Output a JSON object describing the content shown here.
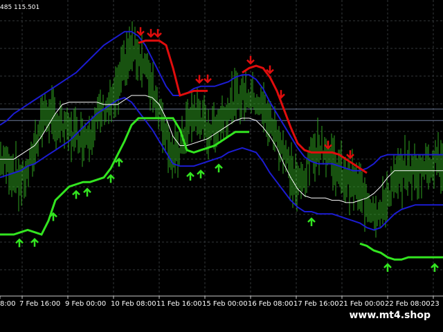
{
  "header": {
    "price_readout": "485 115.501"
  },
  "watermark": "www.mt4.shop",
  "colors": {
    "background": "#000000",
    "grid": "#33373a",
    "price": "#2fa51f",
    "upper_band": "#1c1cd2",
    "lower_band": "#1c1cd2",
    "middle_line": "#ffffff",
    "resistance": "#e00d0d",
    "support": "#33e520",
    "buy_arrow": "#33e520",
    "sell_arrow": "#e00d0d",
    "level_line": "#6e7c9a"
  },
  "chart_data": {
    "type": "line",
    "x_tick_labels": [
      "8:00",
      "7 Feb 16:00",
      "9 Feb 00:00",
      "10 Feb 08:00",
      "11 Feb 16:00",
      "15 Feb 00:00",
      "16 Feb 08:00",
      "17 Feb 16:00",
      "21 Feb 00:00",
      "22 Feb 08:00",
      "23"
    ],
    "x": [
      0,
      10,
      20,
      30,
      40,
      50,
      60,
      70,
      80,
      90,
      100,
      110,
      120,
      130,
      140,
      150,
      160,
      170,
      180,
      190,
      200,
      210,
      220,
      230,
      240,
      250,
      260,
      270,
      280,
      290,
      300,
      310,
      320,
      330,
      340,
      350,
      360,
      370,
      380,
      390,
      400,
      410,
      420,
      430,
      440,
      450,
      460,
      470,
      480,
      490,
      500,
      510,
      520,
      530,
      540,
      550,
      560,
      570,
      580,
      590,
      600,
      610,
      620,
      630,
      640
    ],
    "y_readout": 115.501,
    "series": [
      {
        "role": "price",
        "values": [
          0.4,
          0.38,
          0.34,
          0.3,
          0.34,
          0.45,
          0.58,
          0.6,
          0.56,
          0.54,
          0.52,
          0.51,
          0.5,
          0.52,
          0.58,
          0.62,
          0.64,
          0.7,
          0.82,
          0.88,
          0.86,
          0.8,
          0.72,
          0.62,
          0.52,
          0.4,
          0.44,
          0.54,
          0.6,
          0.58,
          0.52,
          0.54,
          0.58,
          0.62,
          0.66,
          0.68,
          0.68,
          0.66,
          0.62,
          0.56,
          0.5,
          0.44,
          0.34,
          0.28,
          0.32,
          0.42,
          0.46,
          0.44,
          0.4,
          0.34,
          0.32,
          0.3,
          0.26,
          0.22,
          0.18,
          0.16,
          0.24,
          0.3,
          0.34,
          0.36,
          0.34,
          0.36,
          0.38,
          0.4,
          0.4
        ]
      },
      {
        "role": "upper_band",
        "values": [
          0.55,
          0.57,
          0.6,
          0.62,
          0.64,
          0.66,
          0.68,
          0.7,
          0.72,
          0.74,
          0.76,
          0.78,
          0.81,
          0.84,
          0.87,
          0.9,
          0.92,
          0.94,
          0.96,
          0.96,
          0.94,
          0.9,
          0.84,
          0.78,
          0.72,
          0.68,
          0.68,
          0.69,
          0.71,
          0.72,
          0.72,
          0.72,
          0.73,
          0.74,
          0.76,
          0.77,
          0.77,
          0.75,
          0.71,
          0.65,
          0.6,
          0.55,
          0.5,
          0.45,
          0.41,
          0.39,
          0.38,
          0.38,
          0.38,
          0.37,
          0.36,
          0.35,
          0.35,
          0.36,
          0.38,
          0.41,
          0.42,
          0.42,
          0.42,
          0.42,
          0.42,
          0.42,
          0.42,
          0.42,
          0.42
        ]
      },
      {
        "role": "middle_line",
        "values": [
          0.4,
          0.4,
          0.4,
          0.42,
          0.44,
          0.46,
          0.5,
          0.55,
          0.6,
          0.64,
          0.65,
          0.65,
          0.65,
          0.65,
          0.65,
          0.64,
          0.64,
          0.64,
          0.66,
          0.68,
          0.68,
          0.68,
          0.67,
          0.64,
          0.58,
          0.5,
          0.46,
          0.46,
          0.47,
          0.48,
          0.49,
          0.51,
          0.53,
          0.55,
          0.57,
          0.58,
          0.58,
          0.57,
          0.54,
          0.5,
          0.45,
          0.38,
          0.32,
          0.27,
          0.24,
          0.23,
          0.23,
          0.23,
          0.22,
          0.22,
          0.21,
          0.21,
          0.22,
          0.23,
          0.25,
          0.28,
          0.32,
          0.35,
          0.35,
          0.35,
          0.35,
          0.35,
          0.35,
          0.35,
          0.35
        ]
      },
      {
        "role": "lower_band",
        "values": [
          0.32,
          0.33,
          0.34,
          0.35,
          0.37,
          0.38,
          0.4,
          0.42,
          0.44,
          0.46,
          0.48,
          0.51,
          0.54,
          0.57,
          0.6,
          0.62,
          0.64,
          0.66,
          0.67,
          0.65,
          0.61,
          0.57,
          0.53,
          0.48,
          0.43,
          0.38,
          0.37,
          0.37,
          0.37,
          0.38,
          0.39,
          0.4,
          0.41,
          0.43,
          0.44,
          0.45,
          0.44,
          0.43,
          0.39,
          0.34,
          0.3,
          0.26,
          0.22,
          0.19,
          0.17,
          0.17,
          0.16,
          0.16,
          0.16,
          0.15,
          0.14,
          0.13,
          0.12,
          0.1,
          0.09,
          0.1,
          0.13,
          0.16,
          0.18,
          0.19,
          0.2,
          0.2,
          0.2,
          0.2,
          0.2
        ]
      },
      {
        "role": "resistance",
        "values": [
          null,
          null,
          null,
          null,
          null,
          null,
          null,
          null,
          null,
          null,
          null,
          null,
          null,
          null,
          null,
          null,
          null,
          null,
          null,
          null,
          0.91,
          0.92,
          0.92,
          0.92,
          0.9,
          0.8,
          0.68,
          0.69,
          0.7,
          0.7,
          0.7,
          null,
          null,
          null,
          null,
          0.78,
          0.8,
          0.81,
          0.8,
          0.76,
          0.7,
          0.62,
          0.54,
          0.47,
          0.44,
          0.43,
          0.43,
          0.43,
          0.43,
          0.42,
          0.4,
          0.38,
          0.36,
          0.34,
          null,
          null,
          null,
          null,
          null,
          null,
          null,
          null,
          null,
          null,
          null
        ]
      },
      {
        "role": "support",
        "values": [
          0.07,
          0.07,
          0.07,
          0.08,
          0.09,
          0.08,
          0.07,
          0.13,
          0.22,
          0.25,
          0.28,
          0.29,
          0.3,
          0.3,
          0.31,
          0.32,
          0.36,
          0.42,
          0.48,
          0.55,
          0.58,
          0.58,
          0.58,
          0.58,
          0.58,
          0.58,
          0.53,
          0.44,
          0.43,
          0.44,
          0.45,
          0.46,
          0.48,
          0.5,
          0.52,
          0.52,
          0.52,
          null,
          null,
          null,
          null,
          null,
          null,
          null,
          null,
          null,
          null,
          null,
          null,
          null,
          null,
          null,
          0.03,
          0.02,
          0.0,
          -0.01,
          -0.03,
          -0.04,
          -0.04,
          -0.03,
          -0.03,
          -0.03,
          -0.03,
          -0.03,
          -0.03
        ]
      }
    ],
    "level_lines": [
      0.57,
      0.62
    ],
    "buy_arrow_x": [
      28,
      50,
      77,
      110,
      126,
      160,
      172,
      275,
      290,
      316,
      450,
      560,
      628
    ],
    "sell_arrow_x": [
      203,
      218,
      228,
      288,
      300,
      362,
      390,
      406,
      474,
      506
    ],
    "grid": true,
    "ylim": [
      -0.2,
      1.05
    ]
  }
}
